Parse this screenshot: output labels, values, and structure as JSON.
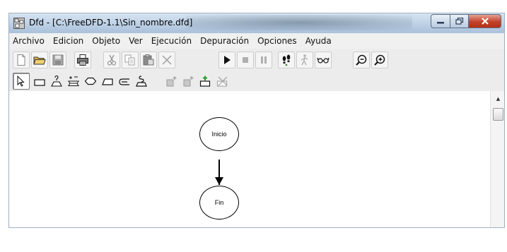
{
  "window": {
    "title": "Dfd - [C:\\FreeDFD-1.1\\Sin_nombre.dfd]"
  },
  "menu": [
    "Archivo",
    "Edicion",
    "Objeto",
    "Ver",
    "Ejecución",
    "Depuración",
    "Opciones",
    "Ayuda"
  ],
  "toolbar_main": [
    {
      "icon": "new-document-icon"
    },
    {
      "icon": "open-folder-icon"
    },
    {
      "icon": "save-disk-icon"
    },
    {
      "icon": "print-icon"
    },
    {
      "icon": "cut-icon"
    },
    {
      "icon": "copy-icon"
    },
    {
      "icon": "paste-icon"
    },
    {
      "icon": "delete-icon"
    },
    {
      "icon": "run-icon"
    },
    {
      "icon": "stop-icon"
    },
    {
      "icon": "pause-icon"
    },
    {
      "icon": "step-footprints-icon"
    },
    {
      "icon": "walk-icon"
    },
    {
      "icon": "watch-glasses-icon"
    },
    {
      "icon": "zoom-out-icon"
    },
    {
      "icon": "zoom-in-icon"
    }
  ],
  "toolbar_objects": [
    {
      "icon": "pointer-icon"
    },
    {
      "icon": "assignment-icon"
    },
    {
      "icon": "read-icon"
    },
    {
      "icon": "loop-icon"
    },
    {
      "icon": "decision-icon"
    },
    {
      "icon": "output-icon"
    },
    {
      "icon": "subprogram-call-icon"
    },
    {
      "icon": "write-icon"
    },
    {
      "icon": "insert-subprogram-icon"
    },
    {
      "icon": "subprogram-icon"
    },
    {
      "icon": "new-subprogram-icon"
    },
    {
      "icon": "delete-subprogram-icon"
    }
  ],
  "diagram": {
    "nodes": [
      {
        "label": "Inicio"
      },
      {
        "label": "Fin"
      }
    ]
  }
}
